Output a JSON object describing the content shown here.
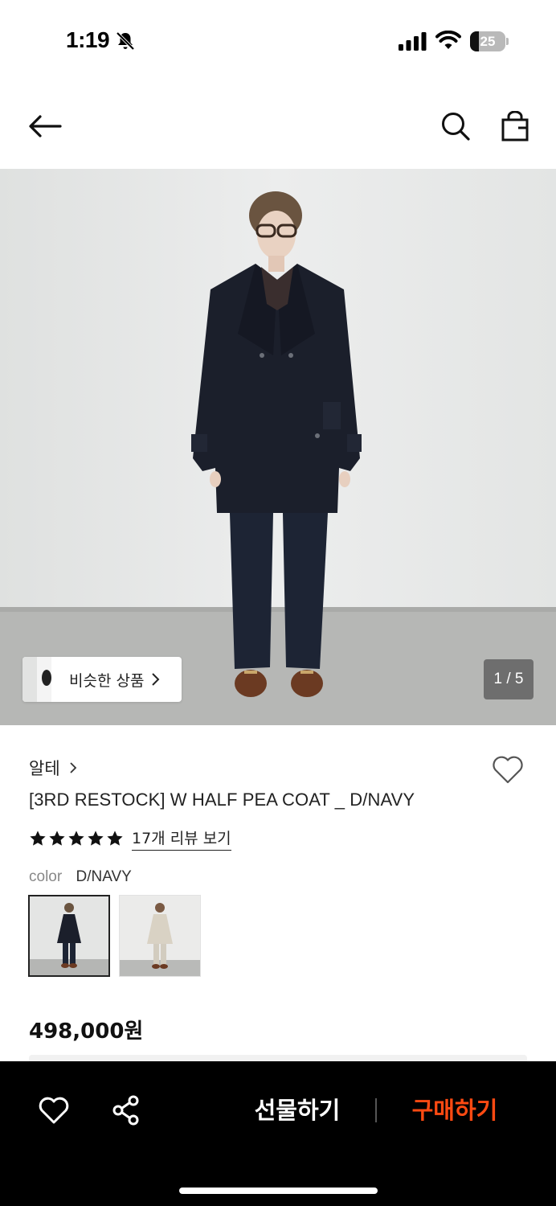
{
  "status_bar": {
    "time": "1:19",
    "battery_level": "25",
    "battery_fraction": 0.25,
    "icons": [
      "bell-slash-icon",
      "signal-icon",
      "wifi-icon",
      "battery-icon"
    ]
  },
  "header": {
    "icons": [
      "back-arrow-icon",
      "search-icon",
      "shopping-bag-icon"
    ]
  },
  "gallery": {
    "similar_label": "비슷한 상품",
    "page_indicator": "1 / 5",
    "current_page": 1,
    "total_pages": 5
  },
  "product": {
    "brand": "알테",
    "title": "[3RD RESTOCK] W HALF PEA COAT _ D/NAVY",
    "rating_stars": 5,
    "review_link": "17개 리뷰 보기",
    "color_label": "color",
    "color_value": "D/NAVY",
    "swatches": [
      "D/NAVY",
      "ivory"
    ],
    "price": "498,000원"
  },
  "bottom_bar": {
    "gift_label": "선물하기",
    "buy_label": "구매하기",
    "icons": [
      "heart-icon",
      "share-icon"
    ]
  },
  "colors": {
    "accent": "#ff4a12",
    "bottom_bar_bg": "#000000",
    "coat": "#1b1f2b"
  }
}
